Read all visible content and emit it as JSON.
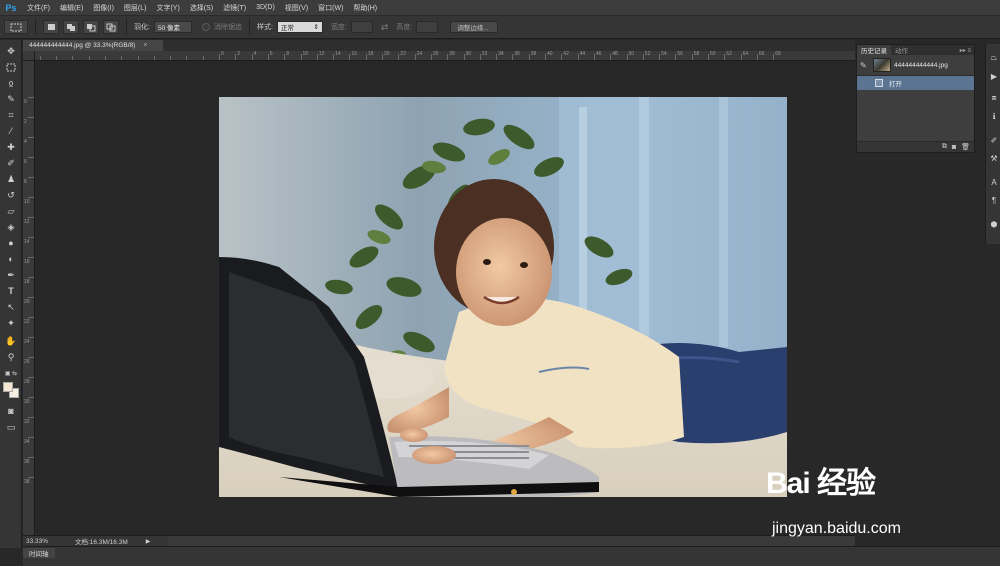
{
  "app": {
    "logo": "Ps",
    "menu": [
      "文件(F)",
      "编辑(E)",
      "图像(I)",
      "图层(L)",
      "文字(Y)",
      "选择(S)",
      "滤镜(T)",
      "3D(D)",
      "视图(V)",
      "窗口(W)",
      "帮助(H)"
    ]
  },
  "options": {
    "feather_label": "羽化:",
    "feather_value": "50 像素",
    "antialias_label": "消除锯齿",
    "style_label": "样式:",
    "style_value": "正常",
    "width_label": "宽度:",
    "height_label": "高度:",
    "refine_button": "调整边缘..."
  },
  "document": {
    "tab_title": "444444444444.jpg @ 33.3%(RGB/8)",
    "close_glyph": "×",
    "zoom": "33.33%",
    "doc_size": "文档:16.3M/16.3M",
    "status_arrow": "▶"
  },
  "ruler": {
    "h_ticks": [
      "0",
      "2",
      "4",
      "6",
      "8",
      "10",
      "12",
      "14",
      "16",
      "18",
      "20",
      "22",
      "24",
      "26",
      "28",
      "30",
      "32",
      "34",
      "36",
      "38",
      "40",
      "42",
      "44",
      "46",
      "48",
      "50",
      "52",
      "54",
      "56",
      "58",
      "60",
      "62",
      "64",
      "66",
      "68"
    ],
    "v_ticks": [
      "0",
      "2",
      "4",
      "6",
      "8",
      "10",
      "12",
      "14",
      "16",
      "18",
      "20",
      "22",
      "24",
      "26",
      "28",
      "30",
      "32",
      "34",
      "36",
      "38"
    ]
  },
  "history_panel": {
    "tabs": [
      "历史记录",
      "动作"
    ],
    "panel_menu": "▸▸ ≡",
    "snapshot_name": "444444444444.jpg",
    "steps": [
      "打开"
    ],
    "footer_icons": [
      "new-document-from-state-icon",
      "snapshot-camera-icon",
      "trash-icon"
    ]
  },
  "timeline": {
    "label": "时间轴"
  },
  "watermark": {
    "logo": "Bai 经验",
    "url": "jingyan.baidu.com"
  },
  "colors": {
    "foreground": "#f6e7d0",
    "background": "#f6efe2",
    "selection": "#5a7492",
    "ps_blue": "#2fa3e9"
  }
}
